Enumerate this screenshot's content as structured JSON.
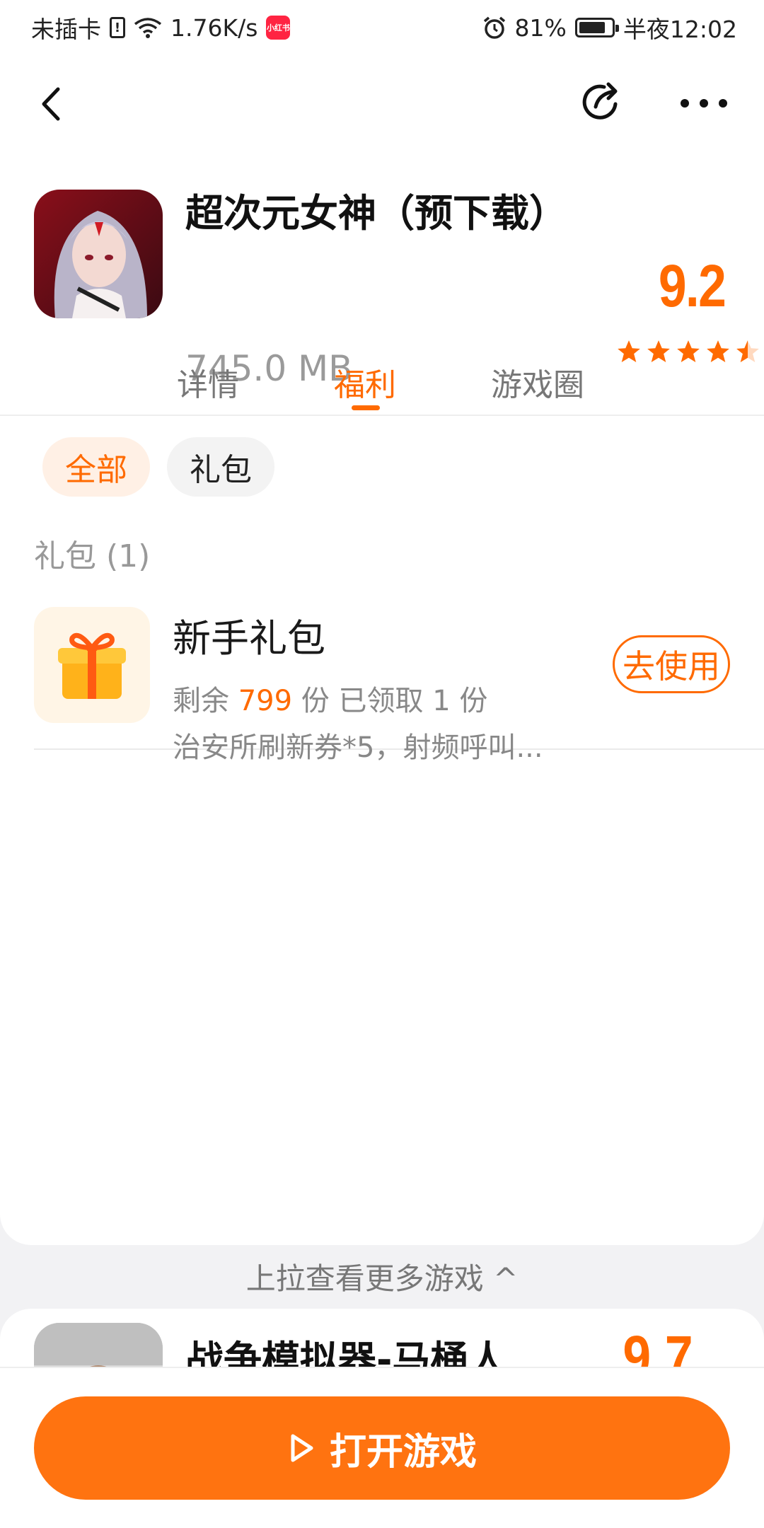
{
  "status_bar": {
    "carrier": "未插卡",
    "net_speed": "1.76K/s",
    "app_badge": "小红书",
    "battery": "81%",
    "time": "半夜12:02"
  },
  "game": {
    "title": "超次元女神（预下载）",
    "size": "745.0 MB",
    "rating": "9.2",
    "stars": 4.5
  },
  "tabs": [
    {
      "label": "详情"
    },
    {
      "label": "福利"
    },
    {
      "label": "游戏圈"
    }
  ],
  "filters": [
    {
      "label": "全部"
    },
    {
      "label": "礼包"
    }
  ],
  "section": {
    "title": "礼包 (1)"
  },
  "gift": {
    "title": "新手礼包",
    "remain_prefix": "剩余",
    "remain_count": "799",
    "remain_suffix": "份 已领取 1 份",
    "description": "治安所刷新券*5，射频呼叫...",
    "button": "去使用"
  },
  "pull_hint": "上拉查看更多游戏 ^",
  "next_game": {
    "title": "战争模拟器-马桶人",
    "rating": "9.7"
  },
  "open_button": "打开游戏",
  "colors": {
    "accent": "#ff6a00",
    "button": "#ff7310"
  }
}
